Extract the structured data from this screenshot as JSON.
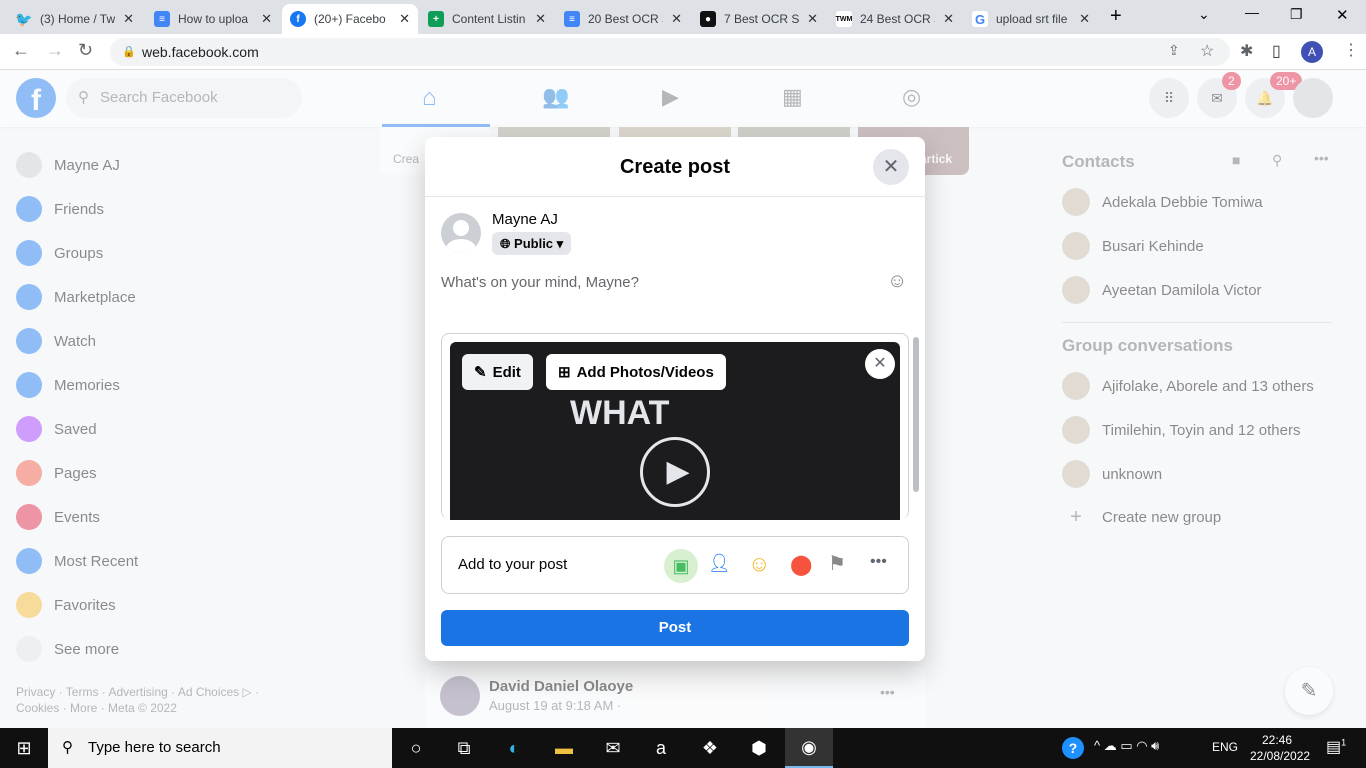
{
  "browser": {
    "tabs": [
      {
        "title": "(3) Home / Tw",
        "icon": "twitter-icon",
        "color": "#1d9bf0"
      },
      {
        "title": "How to uploa",
        "icon": "google-docs-icon",
        "color": "#4285f4"
      },
      {
        "title": "(20+) Facebo",
        "icon": "facebook-icon",
        "color": "#1877f2"
      },
      {
        "title": "Content Listin",
        "icon": "google-sheets-icon",
        "color": "#0f9d58"
      },
      {
        "title": "20 Best OCR S",
        "icon": "google-docs-icon",
        "color": "#4285f4"
      },
      {
        "title": "7 Best OCR So",
        "icon": "site-icon",
        "color": "#111111"
      },
      {
        "title": "24 Best OCR S",
        "icon": "twm-icon",
        "color": "#ffffff"
      },
      {
        "title": "upload srt file",
        "icon": "google-icon",
        "color": "#ffffff"
      }
    ],
    "url": "web.facebook.com",
    "profile_initial": "A"
  },
  "fb": {
    "search_placeholder": "Search Facebook",
    "messenger_badge": "2",
    "notif_badge": "20+",
    "sidebar": [
      "Mayne AJ",
      "Friends",
      "Groups",
      "Marketplace",
      "Watch",
      "Memories",
      "Saved",
      "Pages",
      "Events",
      "Most Recent",
      "Favorites",
      "See more"
    ],
    "footer1": "Privacy · Terms · Advertising · Ad Choices ▷ ·",
    "footer2": "Cookies · More · Meta © 2022",
    "story_create": "Crea",
    "story_name": "artick",
    "contacts_title": "Contacts",
    "contacts": [
      "Adekala Debbie Tomiwa",
      "Busari Kehinde",
      "Ayeetan Damilola Victor"
    ],
    "groups_title": "Group conversations",
    "groups": [
      "Ajifolake, Aborele and 13 others",
      "Timilehin, Toyin and 12 others",
      "unknown"
    ],
    "create_group": "Create new group",
    "feed_post": {
      "author": "David Daniel Olaoye",
      "time": "August 19 at 9:18 AM ·"
    }
  },
  "modal": {
    "title": "Create post",
    "user": "Mayne AJ",
    "audience": "Public",
    "placeholder": "What's on your mind, Mayne?",
    "edit": "Edit",
    "add_media": "Add Photos/Videos",
    "video_text": "WHAT",
    "add_to_post": "Add to your post",
    "post": "Post",
    "accent": "#1b74e4"
  },
  "taskbar": {
    "search": "Type here to search",
    "lang": "ENG",
    "time": "22:46",
    "date": "22/08/2022",
    "notif_count": "1"
  }
}
